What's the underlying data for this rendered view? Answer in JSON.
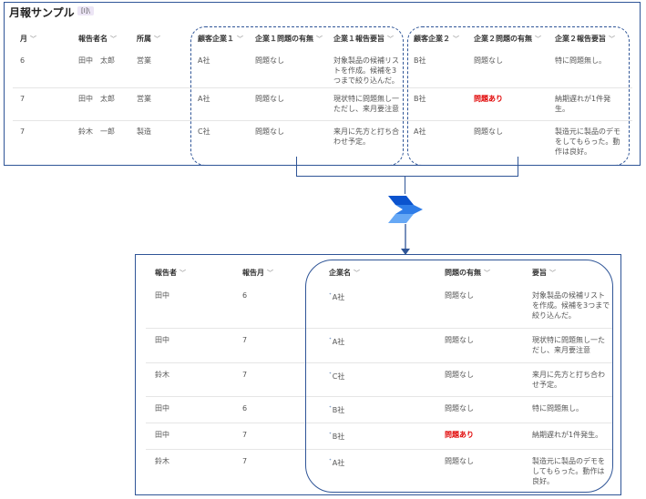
{
  "top": {
    "title": "月報サンプル",
    "view_badge": "[I]\\",
    "columns": [
      "月",
      "報告者名",
      "所属",
      "顧客企業１",
      "企業１問題の有無",
      "企業１報告要旨",
      "顧客企業２",
      "企業２問題の有無",
      "企業２報告要旨"
    ],
    "rows": [
      [
        "6",
        "田中　太郎",
        "営業",
        "A社",
        "問題なし",
        "対象製品の候補リストを作成。候補を3つまで絞り込んだ。",
        "B社",
        "問題なし",
        "特に問題無し。"
      ],
      [
        "7",
        "田中　太郎",
        "営業",
        "A社",
        "問題なし",
        "現状特に問題無し一ただし、来月要注意",
        "B社",
        "問題あり",
        "納期遅れが1件発生。"
      ],
      [
        "7",
        "鈴木　一郎",
        "製造",
        "C社",
        "問題なし",
        "来月に先方と打ち合わせ予定。",
        "A社",
        "問題なし",
        "製造元に製品のデモをしてもらった。動作は良好。"
      ]
    ]
  },
  "bottom": {
    "columns": [
      "報告者",
      "報告月",
      "企業名",
      "問題の有無",
      "要旨"
    ],
    "rows": [
      [
        "田中",
        "6",
        "A社",
        "問題なし",
        "対象製品の候補リストを作成。候補を3つまで絞り込んだ。"
      ],
      [
        "田中",
        "7",
        "A社",
        "問題なし",
        "現状特に問題無し一ただし、来月要注意"
      ],
      [
        "鈴木",
        "7",
        "C社",
        "問題なし",
        "来月に先方と打ち合わせ予定。"
      ],
      [
        "田中",
        "6",
        "B社",
        "問題なし",
        "特に問題無し。"
      ],
      [
        "田中",
        "7",
        "B社",
        "問題あり",
        "納期遅れが1件発生。"
      ],
      [
        "鈴木",
        "7",
        "A社",
        "問題なし",
        "製造元に製品のデモをしてもらった。動作は良好。"
      ]
    ]
  },
  "highlight_value": "問題あり",
  "colors": {
    "accent": "#2f5597",
    "alert": "#e00000"
  }
}
